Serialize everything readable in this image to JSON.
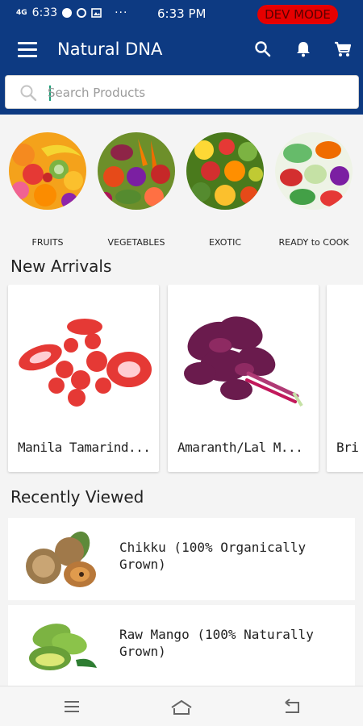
{
  "status_bar": {
    "signal": "4G",
    "left_time": "6:33",
    "dots": "···",
    "center_time": "6:33 PM",
    "badge": "DEV MODE",
    "badge_color": "#e60000"
  },
  "app_bar": {
    "title": "Natural DNA",
    "bg_color": "#0d3a82",
    "icons": [
      "menu-icon",
      "search-icon",
      "bell-icon",
      "cart-icon"
    ]
  },
  "search": {
    "placeholder": "Search Products",
    "value": ""
  },
  "categories": [
    {
      "label": "FRUITS"
    },
    {
      "label": "VEGETABLES"
    },
    {
      "label": "EXOTIC"
    },
    {
      "label": "READY to COOK"
    }
  ],
  "new_arrivals": {
    "title": "New Arrivals",
    "items": [
      {
        "name": "Manila Tamarind..."
      },
      {
        "name": "Amaranth/Lal M..."
      },
      {
        "name": "Bri"
      }
    ]
  },
  "recently_viewed": {
    "title": "Recently Viewed",
    "items": [
      {
        "name": "Chikku (100% Organically Grown)"
      },
      {
        "name": "Raw Mango (100% Naturally Grown)"
      }
    ]
  },
  "nav_bar": {
    "icons": [
      "recents-icon",
      "home-icon",
      "back-icon"
    ]
  }
}
